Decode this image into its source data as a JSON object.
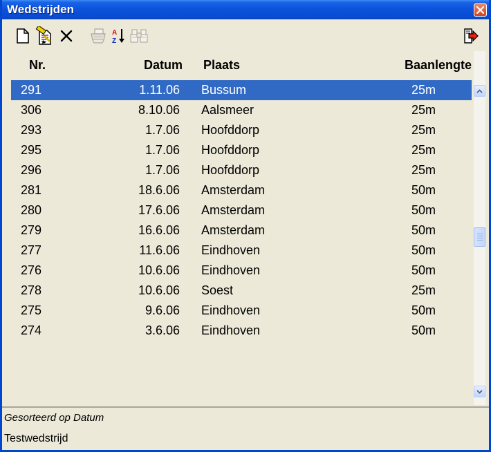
{
  "window": {
    "title": "Wedstrijden"
  },
  "toolbar": {
    "buttons": [
      {
        "name": "new",
        "icon": "new-document-icon",
        "enabled": true
      },
      {
        "name": "edit",
        "icon": "edit-document-icon",
        "enabled": true
      },
      {
        "name": "delete",
        "icon": "delete-x-icon",
        "enabled": true
      },
      {
        "name": "print",
        "icon": "printer-icon",
        "enabled": false
      },
      {
        "name": "sort",
        "icon": "sort-az-icon",
        "enabled": true
      },
      {
        "name": "find",
        "icon": "binoculars-icon",
        "enabled": false
      },
      {
        "name": "exit",
        "icon": "exit-door-icon",
        "enabled": true
      }
    ]
  },
  "table": {
    "columns": {
      "nr": "Nr.",
      "datum": "Datum",
      "plaats": "Plaats",
      "baanlengte": "Baanlengte"
    },
    "rows": [
      {
        "nr": "291",
        "datum": "1.11.06",
        "plaats": "Bussum",
        "baanlengte": "25m",
        "selected": true
      },
      {
        "nr": "306",
        "datum": "8.10.06",
        "plaats": "Aalsmeer",
        "baanlengte": "25m"
      },
      {
        "nr": "293",
        "datum": "1.7.06",
        "plaats": "Hoofddorp",
        "baanlengte": "25m"
      },
      {
        "nr": "295",
        "datum": "1.7.06",
        "plaats": "Hoofddorp",
        "baanlengte": "25m"
      },
      {
        "nr": "296",
        "datum": "1.7.06",
        "plaats": "Hoofddorp",
        "baanlengte": "25m"
      },
      {
        "nr": "281",
        "datum": "18.6.06",
        "plaats": "Amsterdam",
        "baanlengte": "50m"
      },
      {
        "nr": "280",
        "datum": "17.6.06",
        "plaats": "Amsterdam",
        "baanlengte": "50m"
      },
      {
        "nr": "279",
        "datum": "16.6.06",
        "plaats": "Amsterdam",
        "baanlengte": "50m"
      },
      {
        "nr": "277",
        "datum": "11.6.06",
        "plaats": "Eindhoven",
        "baanlengte": "50m"
      },
      {
        "nr": "276",
        "datum": "10.6.06",
        "plaats": "Eindhoven",
        "baanlengte": "50m"
      },
      {
        "nr": "278",
        "datum": "10.6.06",
        "plaats": "Soest",
        "baanlengte": "25m"
      },
      {
        "nr": "275",
        "datum": "9.6.06",
        "plaats": "Eindhoven",
        "baanlengte": "50m"
      },
      {
        "nr": "274",
        "datum": "3.6.06",
        "plaats": "Eindhoven",
        "baanlengte": "50m"
      }
    ]
  },
  "status": {
    "sort_label": "Gesorteerd op Datum",
    "selected_name": "Testwedstrijd"
  },
  "colors": {
    "titlebar": "#0a4bd0",
    "selection": "#316ac5",
    "face": "#ece9d8"
  }
}
